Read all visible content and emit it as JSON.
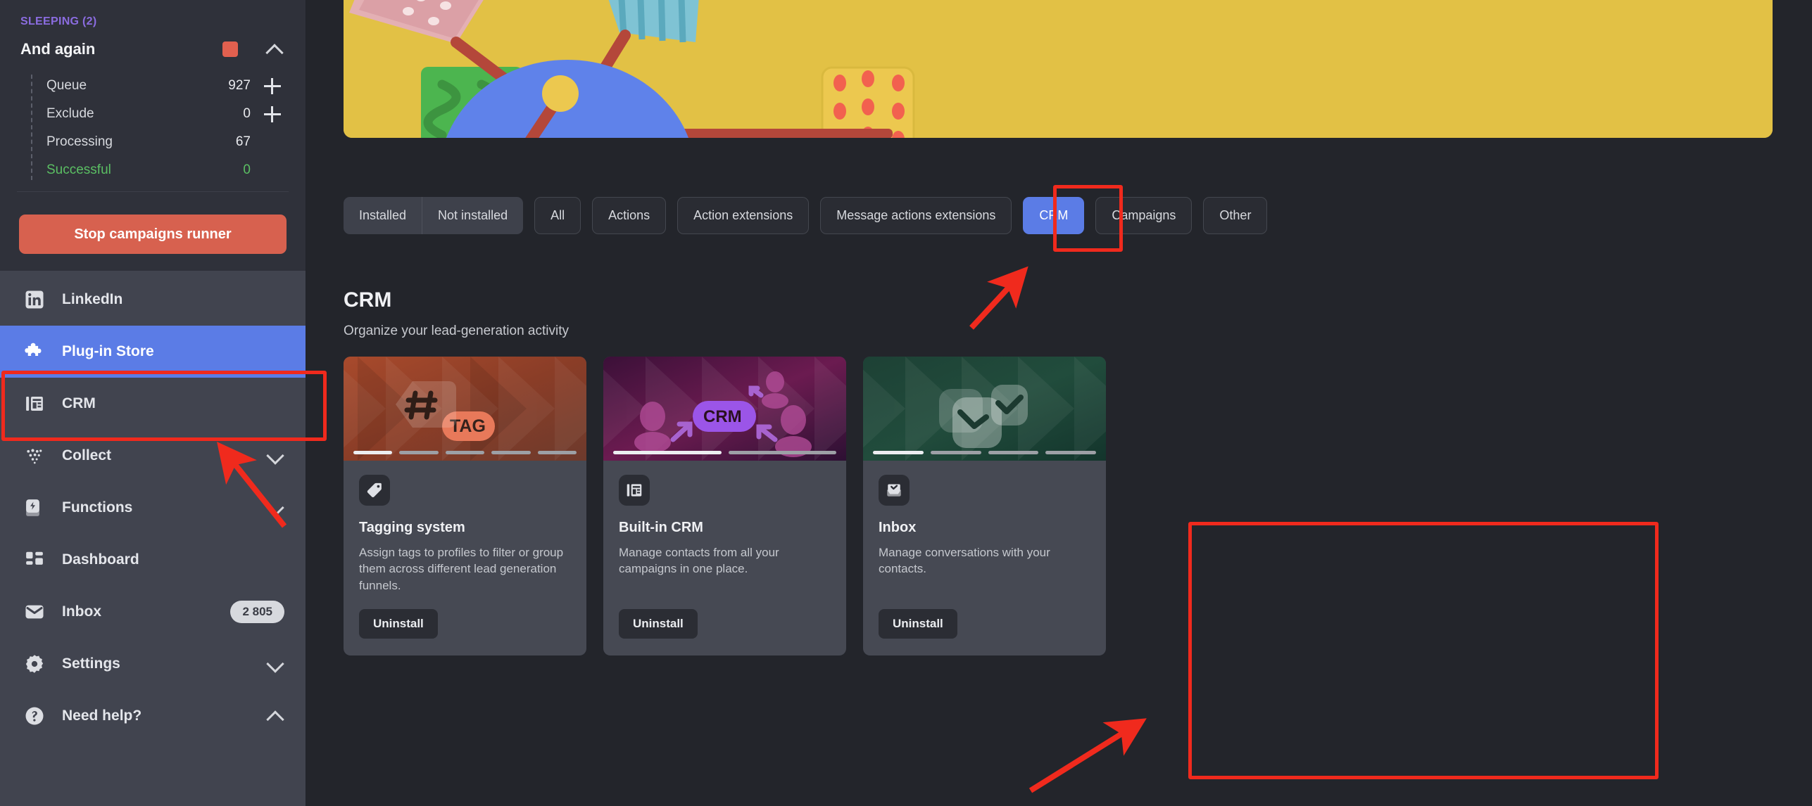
{
  "colors": {
    "accent": "#5b7ce6",
    "danger": "#d7614f",
    "success": "#5bbf63",
    "sleeping": "#8b6ce0",
    "annotation": "#f02a1d",
    "sidebar_bg": "#2f313a",
    "nav_bg": "#41444f",
    "main_bg": "#23252b",
    "card_bg": "#464953",
    "banner_bg": "#e2c145"
  },
  "sidebar": {
    "campaign": {
      "status_label": "SLEEPING (2)",
      "name": "And again",
      "status_dot_color": "#e2604f",
      "collapse_icon": "chevron-up-icon",
      "stats": [
        {
          "label": "Queue",
          "value": "927",
          "add": true,
          "state": "default"
        },
        {
          "label": "Exclude",
          "value": "0",
          "add": true,
          "state": "default"
        },
        {
          "label": "Processing",
          "value": "67",
          "add": false,
          "state": "default"
        },
        {
          "label": "Successful",
          "value": "0",
          "add": false,
          "state": "success"
        }
      ]
    },
    "stop_button": "Stop campaigns runner",
    "items": [
      {
        "label": "LinkedIn",
        "icon": "linkedin-icon",
        "active": false,
        "badge": null,
        "chevron": null
      },
      {
        "label": "Plug-in Store",
        "icon": "puzzle-icon",
        "active": true,
        "badge": null,
        "chevron": null
      },
      {
        "label": "CRM",
        "icon": "crm-icon",
        "active": false,
        "badge": null,
        "chevron": null
      },
      {
        "label": "Collect",
        "icon": "collect-icon",
        "active": false,
        "badge": null,
        "chevron": "down"
      },
      {
        "label": "Functions",
        "icon": "functions-icon",
        "active": false,
        "badge": null,
        "chevron": "down"
      },
      {
        "label": "Dashboard",
        "icon": "dashboard-icon",
        "active": false,
        "badge": null,
        "chevron": null
      },
      {
        "label": "Inbox",
        "icon": "inbox-icon",
        "active": false,
        "badge": "2 805",
        "chevron": null
      },
      {
        "label": "Settings",
        "icon": "gear-icon",
        "active": false,
        "badge": null,
        "chevron": "down"
      },
      {
        "label": "Need help?",
        "icon": "help-icon",
        "active": false,
        "badge": null,
        "chevron": "up"
      }
    ]
  },
  "main": {
    "filter_group": [
      {
        "label": "Installed",
        "selected": false
      },
      {
        "label": "Not installed",
        "selected": false
      }
    ],
    "filters": [
      {
        "label": "All",
        "selected": false
      },
      {
        "label": "Actions",
        "selected": false
      },
      {
        "label": "Action extensions",
        "selected": false
      },
      {
        "label": "Message actions extensions",
        "selected": false
      },
      {
        "label": "CRM",
        "selected": true
      },
      {
        "label": "Campaigns",
        "selected": false
      },
      {
        "label": "Other",
        "selected": false
      }
    ],
    "section": {
      "title": "CRM",
      "subtitle": "Organize your lead-generation activity"
    },
    "cards": [
      {
        "title": "Tagging system",
        "description": "Assign tags to profiles to filter or group them across different lead generation funnels.",
        "button": "Uninstall",
        "icon": "tag-icon",
        "thumb_label": "TAG",
        "thumb_theme": "orange",
        "dots_total": 5,
        "dots_active": 1
      },
      {
        "title": "Built-in CRM",
        "description": "Manage contacts from all your campaigns in one place.",
        "button": "Uninstall",
        "icon": "crm-panel-icon",
        "thumb_label": "CRM",
        "thumb_theme": "purple",
        "dots_total": 2,
        "dots_active": 1
      },
      {
        "title": "Inbox",
        "description": "Manage conversations with your contacts.",
        "button": "Uninstall",
        "icon": "inbox-check-icon",
        "thumb_label": "",
        "thumb_theme": "green",
        "dots_total": 4,
        "dots_active": 1
      }
    ]
  },
  "annotations": {
    "boxes": [
      {
        "name": "plug-in-store-highlight"
      },
      {
        "name": "crm-tab-highlight"
      },
      {
        "name": "inbox-card-highlight"
      }
    ],
    "arrows": [
      {
        "name": "arrow-to-crm-tab"
      },
      {
        "name": "arrow-to-plug-in-store"
      },
      {
        "name": "arrow-to-inbox-card"
      }
    ]
  }
}
